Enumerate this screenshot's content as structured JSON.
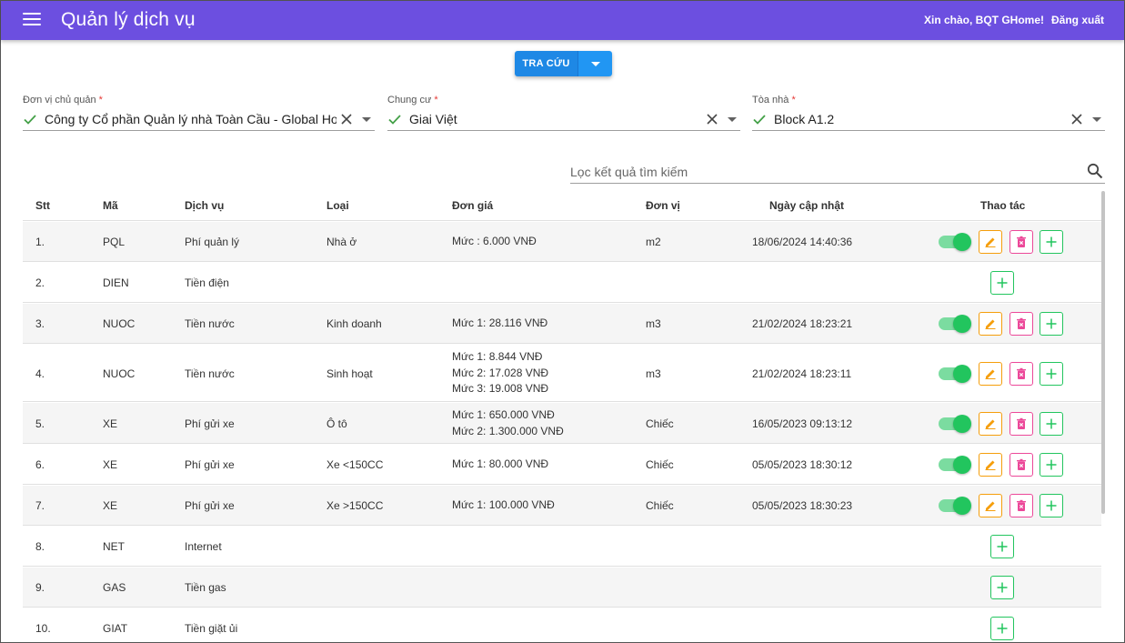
{
  "header": {
    "title": "Quản lý dịch vụ",
    "greeting": "Xin chào, BQT GHome!",
    "logout": "Đăng xuất"
  },
  "search_button": {
    "label": "TRA CỨU"
  },
  "fields": [
    {
      "label": "Đơn vị chủ quản",
      "value": "Công ty Cổ phần Quản lý nhà Toàn Cầu - Global Ho"
    },
    {
      "label": "Chung cư",
      "value": "Giai Việt"
    },
    {
      "label": "Tòa nhà",
      "value": "Block A1.2"
    }
  ],
  "required_mark": "*",
  "filter": {
    "placeholder": "Lọc kết quả tìm kiếm"
  },
  "columns": {
    "stt": "Stt",
    "ma": "Mã",
    "dich_vu": "Dịch vụ",
    "loai": "Loại",
    "don_gia": "Đơn giá",
    "don_vi": "Đơn vị",
    "ngay_cap_nhat": "Ngày cập nhật",
    "thao_tac": "Thao tác"
  },
  "rows": [
    {
      "stt": "1.",
      "ma": "PQL",
      "dich_vu": "Phí quản lý",
      "loai": "Nhà ở",
      "don_gia": [
        "Mức : 6.000 VNĐ"
      ],
      "don_vi": "m2",
      "ngay_cap_nhat": "18/06/2024 14:40:36",
      "active": true
    },
    {
      "stt": "2.",
      "ma": "DIEN",
      "dich_vu": "Tiền điện",
      "loai": "",
      "don_gia": [],
      "don_vi": "",
      "ngay_cap_nhat": "",
      "active": null
    },
    {
      "stt": "3.",
      "ma": "NUOC",
      "dich_vu": "Tiền nước",
      "loai": "Kinh doanh",
      "don_gia": [
        "Mức 1: 28.116 VNĐ"
      ],
      "don_vi": "m3",
      "ngay_cap_nhat": "21/02/2024 18:23:21",
      "active": true
    },
    {
      "stt": "4.",
      "ma": "NUOC",
      "dich_vu": "Tiền nước",
      "loai": "Sinh hoạt",
      "don_gia": [
        "Mức 1: 8.844 VNĐ",
        "Mức 2: 17.028 VNĐ",
        "Mức 3: 19.008 VNĐ"
      ],
      "don_vi": "m3",
      "ngay_cap_nhat": "21/02/2024 18:23:11",
      "active": true
    },
    {
      "stt": "5.",
      "ma": "XE",
      "dich_vu": "Phí gửi xe",
      "loai": "Ô tô",
      "don_gia": [
        "Mức 1: 650.000 VNĐ",
        "Mức 2: 1.300.000 VNĐ"
      ],
      "don_vi": "Chiếc",
      "ngay_cap_nhat": "16/05/2023 09:13:12",
      "active": true
    },
    {
      "stt": "6.",
      "ma": "XE",
      "dich_vu": "Phí gửi xe",
      "loai": "Xe <150CC",
      "don_gia": [
        "Mức 1: 80.000 VNĐ"
      ],
      "don_vi": "Chiếc",
      "ngay_cap_nhat": "05/05/2023 18:30:12",
      "active": true
    },
    {
      "stt": "7.",
      "ma": "XE",
      "dich_vu": "Phí gửi xe",
      "loai": "Xe >150CC",
      "don_gia": [
        "Mức 1: 100.000 VNĐ"
      ],
      "don_vi": "Chiếc",
      "ngay_cap_nhat": "05/05/2023 18:30:23",
      "active": true
    },
    {
      "stt": "8.",
      "ma": "NET",
      "dich_vu": "Internet",
      "loai": "",
      "don_gia": [],
      "don_vi": "",
      "ngay_cap_nhat": "",
      "active": null
    },
    {
      "stt": "9.",
      "ma": "GAS",
      "dich_vu": "Tiền gas",
      "loai": "",
      "don_gia": [],
      "don_vi": "",
      "ngay_cap_nhat": "",
      "active": null
    },
    {
      "stt": "10.",
      "ma": "GIAT",
      "dich_vu": "Tiền giặt ủi",
      "loai": "",
      "don_gia": [],
      "don_vi": "",
      "ngay_cap_nhat": "",
      "active": null
    }
  ],
  "colors": {
    "topbar": "#6c4fe0",
    "primary_button": "#1e88e5",
    "check": "#43a047",
    "toggle_on": "#22c55e",
    "edit": "#f59e0b",
    "delete": "#ec4899",
    "add": "#22c55e"
  },
  "icons": {
    "menu": "menu-icon",
    "check": "check-icon",
    "clear": "close-icon",
    "dropdown": "chevron-down-icon",
    "search": "search-icon",
    "edit": "pencil-icon",
    "delete": "trash-icon",
    "add": "plus-icon"
  }
}
